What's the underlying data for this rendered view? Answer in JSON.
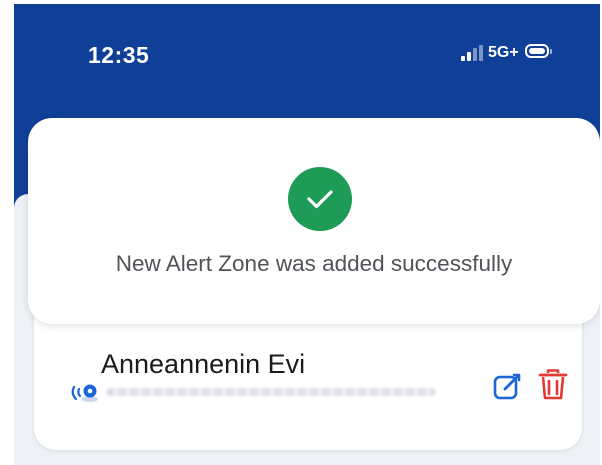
{
  "status_bar": {
    "time": "12:35",
    "network": "5G+",
    "signal_bars_active": 2,
    "battery_icon": "battery-icon"
  },
  "alert": {
    "icon": "check-circle-icon",
    "message": "New Alert Zone was added successfully",
    "icon_color": "#1e9b57"
  },
  "zone": {
    "name": "Anneannenin Evi",
    "location_icon": "location-pin-icon",
    "edit_icon": "edit-icon",
    "delete_icon": "trash-icon",
    "edit_color": "#1a66d9",
    "delete_color": "#e53935"
  },
  "colors": {
    "header_background": "#103f97",
    "panel_background": "#eef2f6"
  }
}
